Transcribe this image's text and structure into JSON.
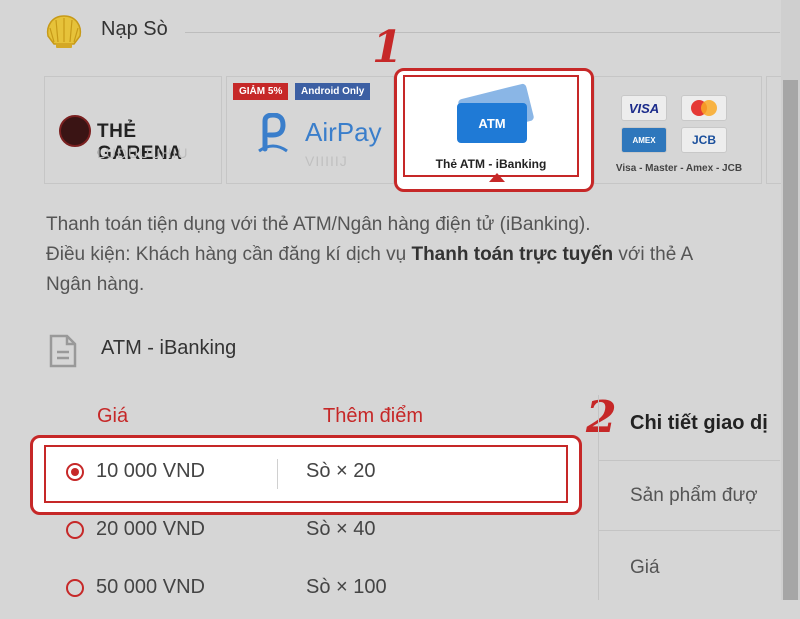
{
  "header": {
    "title": "Nạp Sò"
  },
  "payment_methods": {
    "garena": {
      "label": "THẺ GARENA",
      "ghost": "LUDUUUHIU"
    },
    "airpay": {
      "label": "AirPay",
      "badge_discount": "GIẢM 5%",
      "badge_android": "Android Only",
      "ghost": "VIIIIIJ"
    },
    "atm": {
      "card_text": "ATM",
      "label": "Thẻ ATM - iBanking"
    },
    "cards": {
      "visa": "VISA",
      "amex": "AMEX",
      "jcb": "JCB",
      "label": "Visa - Master - Amex - JCB"
    }
  },
  "annotations": {
    "step1": "1",
    "step2": "2"
  },
  "description": {
    "line1": "Thanh toán tiện dụng với thẻ ATM/Ngân hàng điện tử (iBanking).",
    "line2_prefix": "Điều kiện: Khách hàng cần đăng kí dịch vụ ",
    "line2_bold": "Thanh toán trực tuyến",
    "line2_suffix": " với thẻ A",
    "line3": "Ngân hàng."
  },
  "section": {
    "title": "ATM - iBanking"
  },
  "price_table": {
    "col_price": "Giá",
    "col_points": "Thêm điểm",
    "rows": [
      {
        "price": "10 000 VND",
        "points": "Sò × 20",
        "selected": true
      },
      {
        "price": "20 000 VND",
        "points": "Sò × 40",
        "selected": false
      },
      {
        "price": "50 000 VND",
        "points": "Sò × 100",
        "selected": false
      }
    ]
  },
  "detail_panel": {
    "title": "Chi tiết giao dị",
    "product": "Sản phẩm đượ",
    "price": "Giá"
  },
  "colors": {
    "accent": "#c62828",
    "atm_blue": "#1f7ad6",
    "airpay_blue": "#3a7ecb"
  }
}
